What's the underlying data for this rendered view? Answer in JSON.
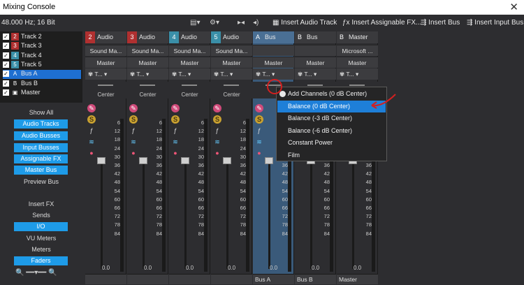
{
  "window": {
    "title": "Mixing Console",
    "close": "✕"
  },
  "toolbar": {
    "format": "48.000 Hz; 16 Bit",
    "items": [
      "Insert Audio Track",
      "Insert Assignable FX...",
      "Insert Bus",
      "Insert Input Bus"
    ],
    "icons": {
      "display": "▤▾",
      "settings": "⚙▾",
      "solo": "▸◂",
      "mute": "◂)"
    }
  },
  "tracklist": [
    {
      "num": "2",
      "label": "Track 2",
      "color": "#b03030",
      "checked": "✓"
    },
    {
      "num": "3",
      "label": "Track 3",
      "color": "#b03030",
      "checked": "✓"
    },
    {
      "num": "4",
      "label": "Track 4",
      "color": "#3a8fa8",
      "checked": "✓"
    },
    {
      "num": "5",
      "label": "Track 5",
      "color": "#3a8fa8",
      "checked": "✓"
    },
    {
      "num": "A",
      "label": "Bus A",
      "color": "#1e6fd1",
      "checked": "✓",
      "selected": true
    },
    {
      "num": "B",
      "label": "Bus B",
      "color": "#1e1e1e",
      "checked": "✓"
    },
    {
      "num": "▣",
      "label": "Master",
      "color": "#1e1e1e",
      "checked": "✓"
    }
  ],
  "leftnav": {
    "show_all": "Show All",
    "buttons1": [
      "Audio Tracks",
      "Audio Busses",
      "Input Busses",
      "Assignable FX",
      "Master Bus"
    ],
    "preview": "Preview Bus",
    "insert_fx": "Insert FX",
    "sends": "Sends",
    "io": "I/O",
    "vu": "VU Meters",
    "meters": "Meters",
    "faders": "Faders",
    "zoom": "🔍 ━━▾━━ 🔍"
  },
  "strips": [
    {
      "num": "2",
      "name": "Audio",
      "color": "#b03030",
      "input": "Sound Ma...",
      "output": "Master",
      "fx": "T...",
      "pan": "Center",
      "value": "0.0",
      "route": ""
    },
    {
      "num": "3",
      "name": "Audio",
      "color": "#b03030",
      "input": "Sound Ma...",
      "output": "Master",
      "fx": "T...",
      "pan": "Center",
      "value": "0.0",
      "route": ""
    },
    {
      "num": "4",
      "name": "Audio",
      "color": "#3a8fa8",
      "input": "Sound Ma...",
      "output": "Master",
      "fx": "T...",
      "pan": "Center",
      "value": "0.0",
      "route": ""
    },
    {
      "num": "5",
      "name": "Audio",
      "color": "#3a8fa8",
      "input": "Sound Ma...",
      "output": "Master",
      "fx": "T...",
      "pan": "Center",
      "value": "0.0",
      "route": ""
    },
    {
      "num": "A",
      "name": "Bus",
      "color": "#4a6f94",
      "input": "",
      "output": "Master",
      "fx": "T...",
      "pan": "",
      "value": "0.0",
      "route": "Bus A"
    },
    {
      "num": "B",
      "name": "Bus",
      "color": "#3a3a3d",
      "input": "",
      "output": "Master",
      "fx": "T...",
      "pan": "",
      "value": "0.0",
      "route": "Bus B"
    },
    {
      "num": "B",
      "name": "Master",
      "color": "#3a3a3d",
      "input": "Microsoft ...",
      "output": "Master",
      "fx": "T...",
      "pan": "",
      "value": "0.0",
      "route": "Master"
    }
  ],
  "scale": [
    "6",
    "12",
    "18",
    "24",
    "30",
    "36",
    "42",
    "48",
    "54",
    "60",
    "66",
    "72",
    "78",
    "84"
  ],
  "menu": {
    "items": [
      "Add Channels (0 dB Center)",
      "Balance (0 dB Center)",
      "Balance (-3 dB Center)",
      "Balance (-6 dB Center)",
      "Constant Power",
      "Film"
    ],
    "highlighted": 1,
    "checked": 0
  }
}
